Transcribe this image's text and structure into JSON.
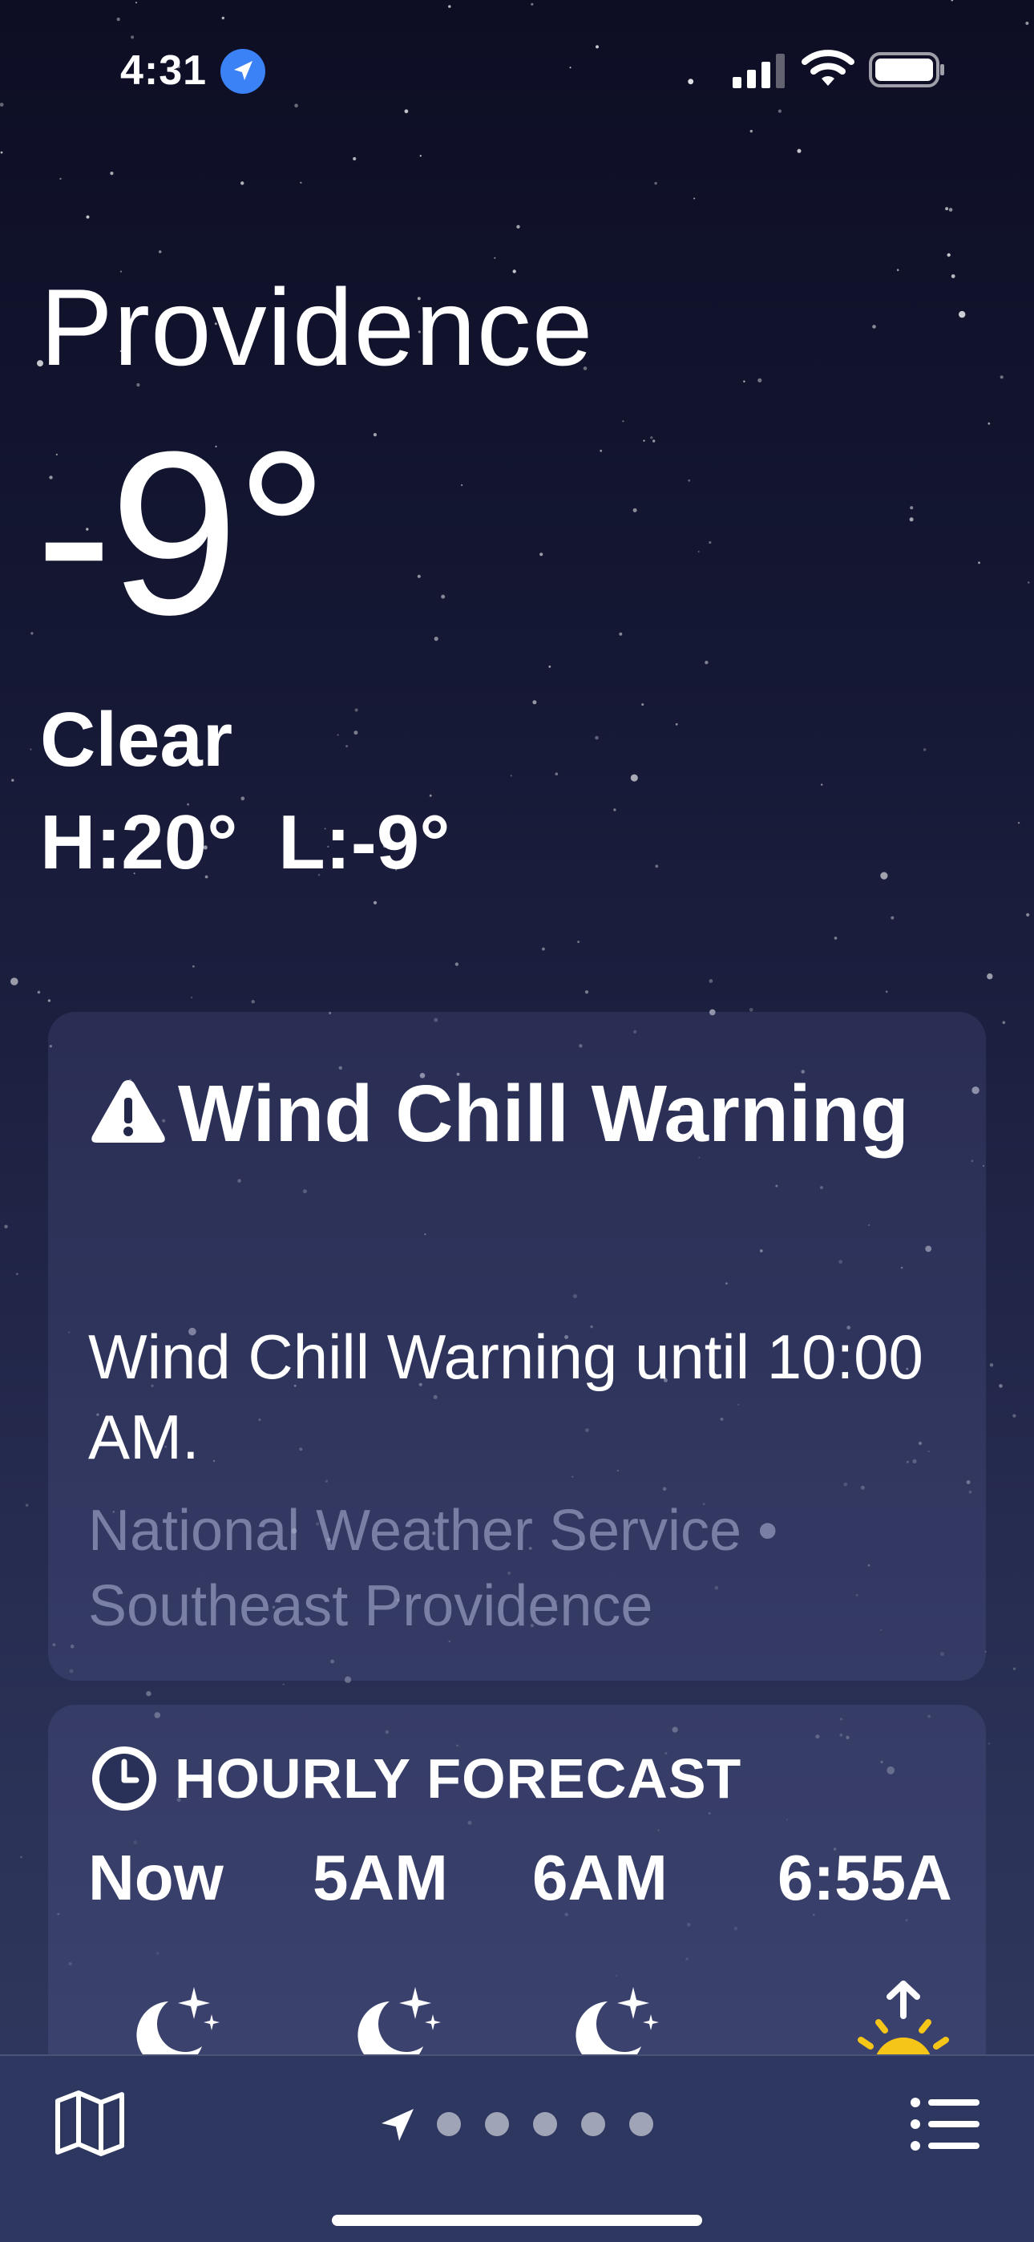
{
  "status_bar": {
    "time": "4:31",
    "location_icon": "location-arrow-icon",
    "signal_icon": "cellular-signal-icon",
    "wifi_icon": "wifi-icon",
    "battery_icon": "battery-icon"
  },
  "header": {
    "city": "Providence",
    "temperature": "-9°",
    "condition": "Clear",
    "high_low": "H:20° L:-9°"
  },
  "alert": {
    "icon": "warning-triangle-icon",
    "title": "Wind Chill Warning",
    "body": "Wind Chill Warning until 10:00 AM.",
    "source": "National Weather Service • Southeast Providence"
  },
  "hourly": {
    "icon": "clock-icon",
    "title": "HOURLY FORECAST",
    "hours": [
      {
        "label": "Now",
        "icon": "moon-stars-icon"
      },
      {
        "label": "5AM",
        "icon": "moon-stars-icon"
      },
      {
        "label": "6AM",
        "icon": "moon-stars-icon"
      },
      {
        "label": "6:55A",
        "icon": "sunrise-icon"
      }
    ]
  },
  "toolbar": {
    "map_icon": "map-icon",
    "page_indicator": {
      "current_icon": "location-arrow-icon",
      "dots": 5
    },
    "list_icon": "list-icon"
  },
  "colors": {
    "background_top": "#0d0e24",
    "background_bottom": "#323a62",
    "location_badge": "#3b82f6",
    "sunrise_yellow": "#f5c518",
    "muted_text": "#7d84a8"
  }
}
